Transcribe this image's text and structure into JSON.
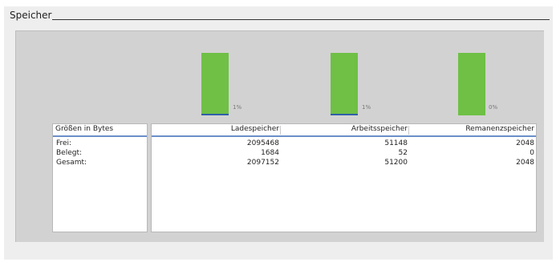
{
  "section": {
    "title": "Speicher"
  },
  "bars": [
    {
      "name": "ladespeicher",
      "used_percent": 1,
      "label": "1%"
    },
    {
      "name": "arbeitsspeicher",
      "used_percent": 1,
      "label": "1%"
    },
    {
      "name": "remanenzspeicher",
      "used_percent": 0,
      "label": "0%"
    }
  ],
  "colors": {
    "free": "#6fc045",
    "used": "#2f5fa8",
    "header_line": "#6b8fc8"
  },
  "labels_table": {
    "header": "Größen in Bytes",
    "rows": [
      "Frei:",
      "Belegt:",
      "Gesamt:"
    ]
  },
  "values_table": {
    "headers": [
      "Ladespeicher",
      "Arbeitsspeicher",
      "Remanenzspeicher"
    ],
    "rows": [
      [
        "2095468",
        "51148",
        "2048"
      ],
      [
        "1684",
        "52",
        "0"
      ],
      [
        "2097152",
        "51200",
        "2048"
      ]
    ]
  }
}
